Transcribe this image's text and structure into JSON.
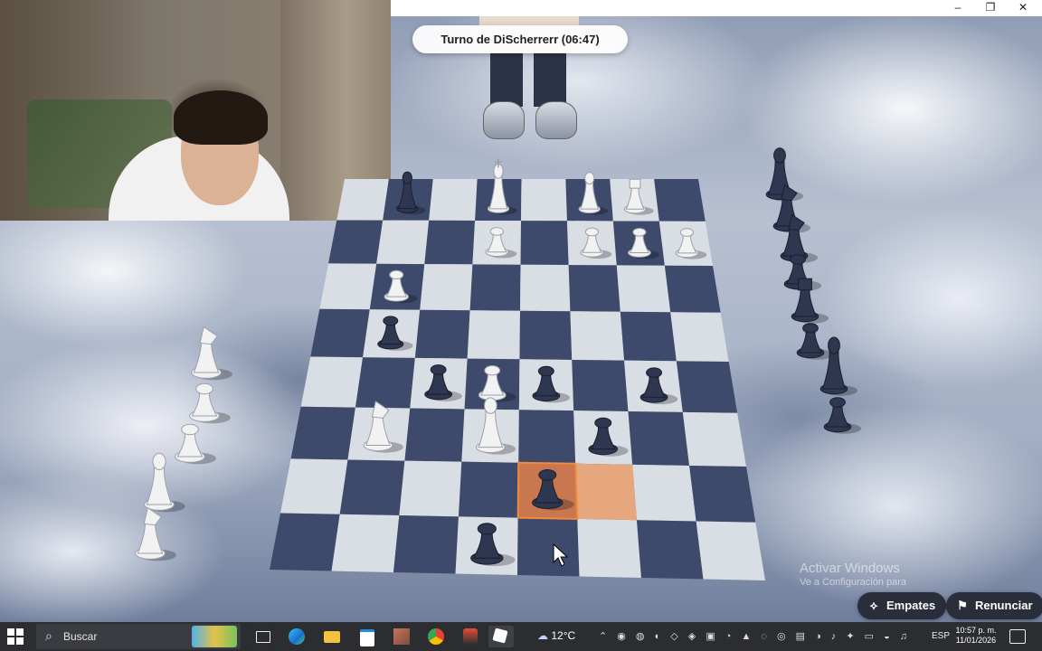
{
  "window": {
    "minimize_glyph": "–",
    "maximize_glyph": "❐",
    "close_glyph": "✕"
  },
  "game": {
    "turn_text": "Turno de DiScherrerr (06:47)",
    "draw_button": "Empates",
    "resign_button": "Renunciar",
    "draw_icon": "handshake-icon",
    "resign_icon": "flag-icon"
  },
  "watermark": {
    "line1": "Activar Windows",
    "line2": "Ve a Configuración para"
  },
  "taskbar": {
    "search_placeholder": "Buscar",
    "weather_temp": "12°C",
    "language": "ESP",
    "time": "10:57 p. m.",
    "date": "11/01/2026"
  },
  "colors": {
    "light_square": "#d9dde4",
    "dark_square": "#3e4a6b",
    "highlight_light": "#e6a77f",
    "highlight_dark": "#c9774f",
    "highlight_border": "#f08a3c",
    "white_piece": "#f2f2f2",
    "black_piece": "#2e3650"
  },
  "board": {
    "orientation": "black-bottom",
    "pieces": [
      {
        "color": "white",
        "type": "pawn",
        "file": "a",
        "rank": 7
      },
      {
        "color": "white",
        "type": "pawn",
        "file": "b",
        "rank": 7
      },
      {
        "color": "white",
        "type": "pawn",
        "file": "c",
        "rank": 7
      },
      {
        "color": "white",
        "type": "pawn",
        "file": "e",
        "rank": 7
      },
      {
        "color": "white",
        "type": "rook",
        "file": "b",
        "rank": 8
      },
      {
        "color": "white",
        "type": "bishop",
        "file": "c",
        "rank": 8
      },
      {
        "color": "white",
        "type": "king",
        "file": "e",
        "rank": 8
      },
      {
        "color": "white",
        "type": "pawn",
        "file": "g",
        "rank": 6
      },
      {
        "color": "white",
        "type": "pawn",
        "file": "e",
        "rank": 4
      },
      {
        "color": "white",
        "type": "bishop",
        "file": "e",
        "rank": 3
      },
      {
        "color": "white",
        "type": "knight",
        "file": "g",
        "rank": 3
      },
      {
        "color": "black",
        "type": "bishop",
        "file": "g",
        "rank": 8
      },
      {
        "color": "black",
        "type": "pawn",
        "file": "g",
        "rank": 5
      },
      {
        "color": "black",
        "type": "pawn",
        "file": "b",
        "rank": 4
      },
      {
        "color": "black",
        "type": "pawn",
        "file": "d",
        "rank": 4
      },
      {
        "color": "black",
        "type": "pawn",
        "file": "f",
        "rank": 4
      },
      {
        "color": "black",
        "type": "pawn",
        "file": "c",
        "rank": 3
      },
      {
        "color": "black",
        "type": "pawn",
        "file": "d",
        "rank": 2
      },
      {
        "color": "black",
        "type": "pawn",
        "file": "e",
        "rank": 1
      }
    ],
    "highlight_squares": [
      {
        "file": "c",
        "rank": 2
      },
      {
        "file": "d",
        "rank": 2
      }
    ]
  },
  "captured_white": [
    "knight",
    "pawn",
    "pawn",
    "bishop",
    "knight"
  ],
  "captured_black": [
    "bishop",
    "knight",
    "knight",
    "pawn",
    "rook",
    "pawn",
    "queen",
    "pawn"
  ]
}
